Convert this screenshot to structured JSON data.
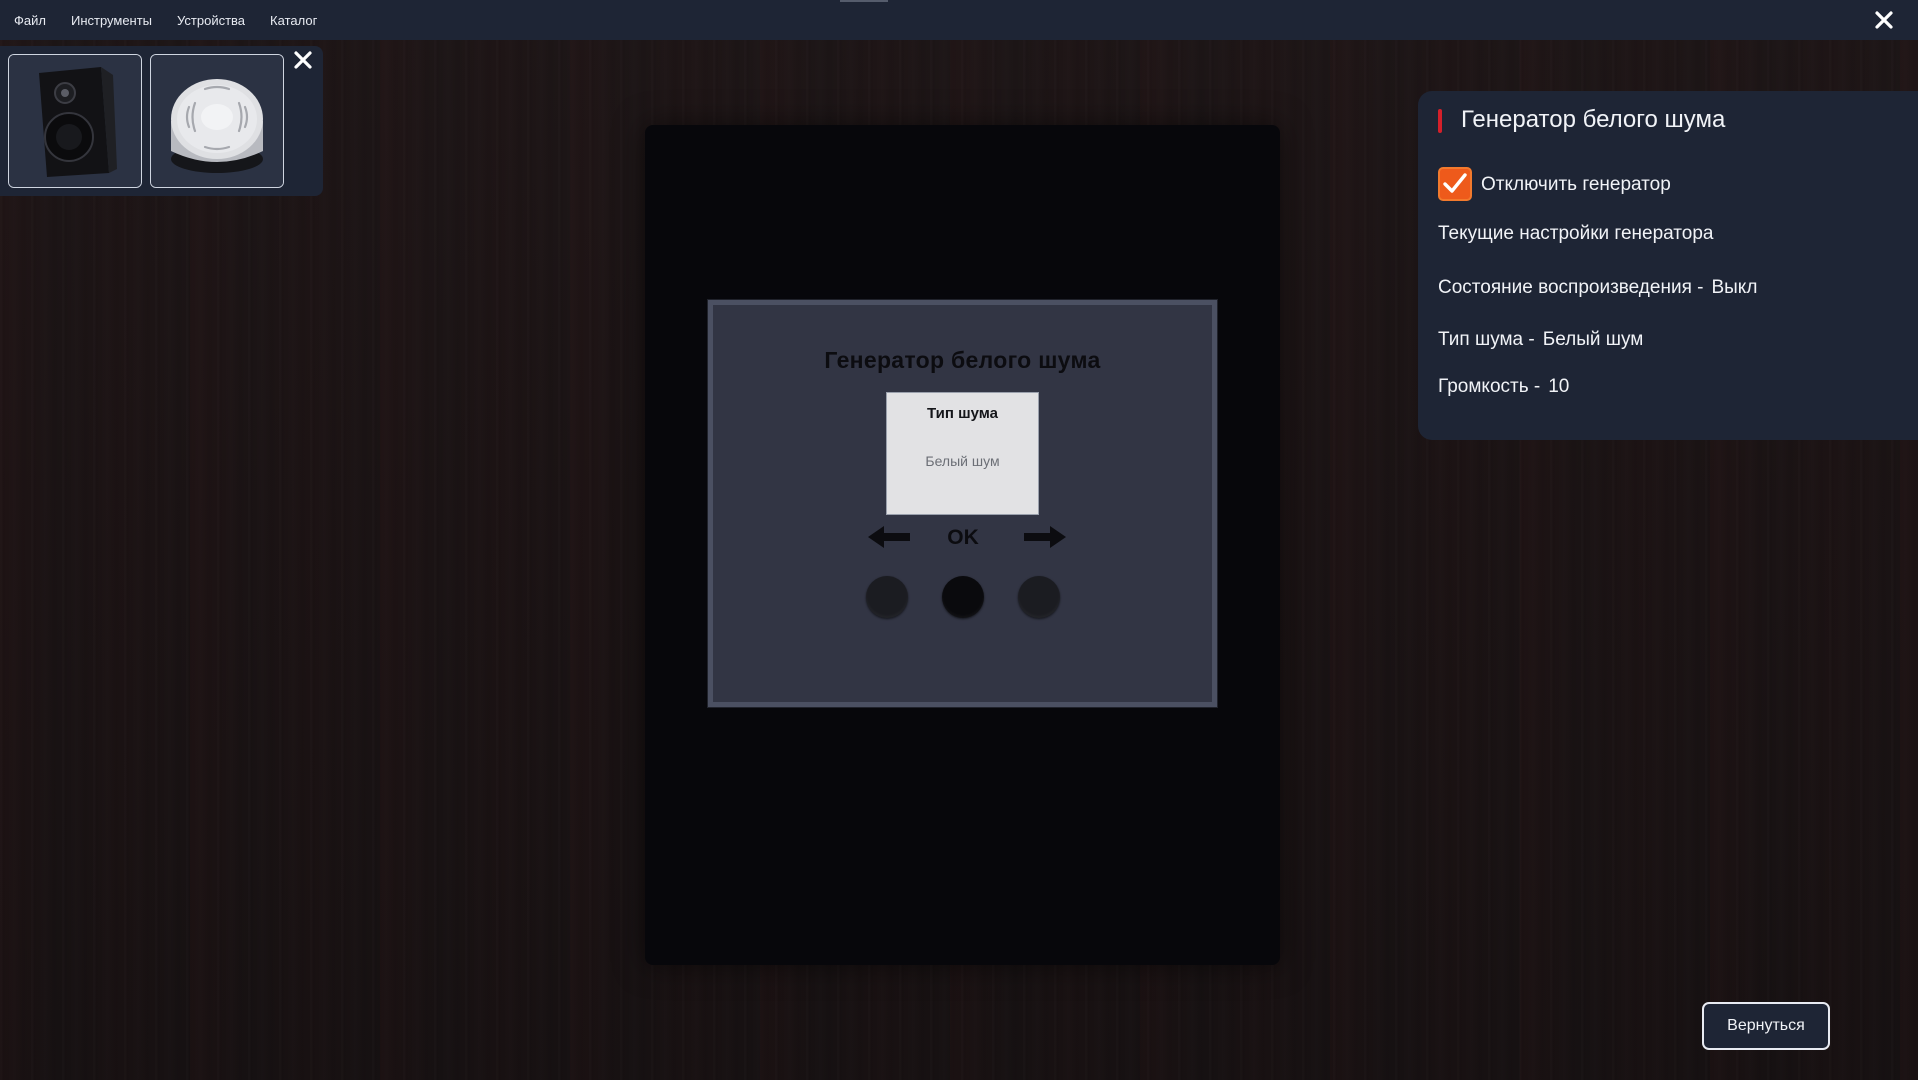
{
  "menu": {
    "items": [
      "Файл",
      "Инструменты",
      "Устройства",
      "Каталог"
    ]
  },
  "icons": {
    "app_close": "close-icon",
    "thumbs_close": "close-icon",
    "arrow_left": "arrow-left-icon",
    "arrow_right": "arrow-right-icon",
    "checkmark": "checkmark-icon"
  },
  "devices": [
    {
      "name": "speaker",
      "thumbnail": "speaker-thumbnail"
    },
    {
      "name": "white-noise-generator",
      "thumbnail": "round-puck-device-thumbnail"
    }
  ],
  "device_screen": {
    "title": "Генератор белого шума",
    "box_title": "Тип шума",
    "box_value": "Белый шум",
    "ok_label": "OK"
  },
  "info_panel": {
    "title": "Генератор белого шума",
    "checkbox_label": "Отключить генератор",
    "checkbox_checked": true,
    "current_settings": "Текущие настройки генератора",
    "playback_label": "Состояние воспроизведения -",
    "playback_value": "Выкл",
    "noise_type_label": "Тип шума -",
    "noise_type_value": "Белый шум",
    "volume_label": "Громкость -",
    "volume_value": "10"
  },
  "back_button": "Вернуться",
  "colors": {
    "panel_bg": "#1e2535",
    "accent_red": "#d4202a",
    "checkbox_orange": "#ee5a1b",
    "screen_bg": "#323544",
    "screen_border": "#4b5062"
  }
}
